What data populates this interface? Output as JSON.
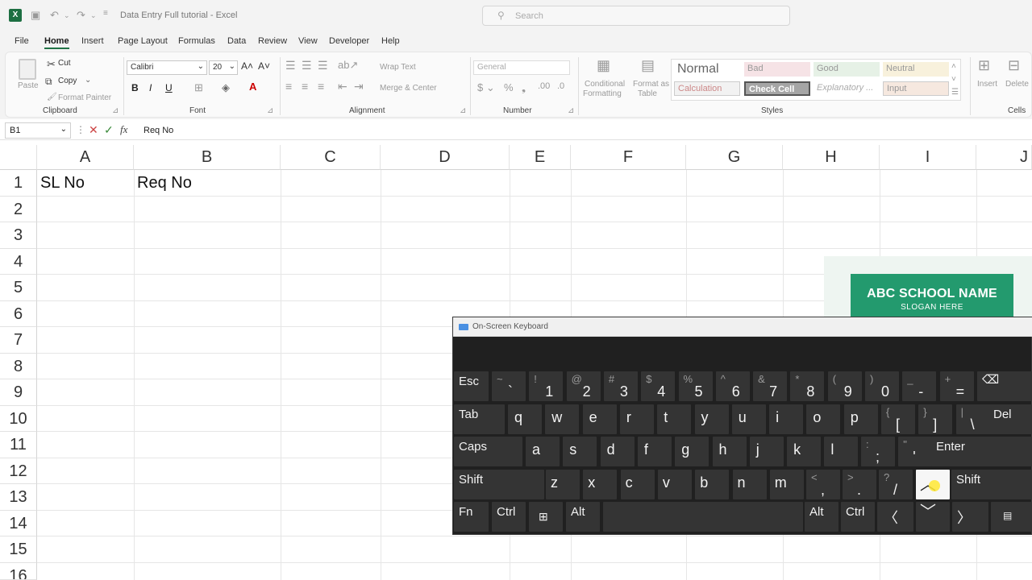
{
  "titlebar": {
    "title": "Data Entry Full tutorial  -  Excel",
    "search_placeholder": "Search",
    "logo": "X"
  },
  "menu": [
    "File",
    "Home",
    "Insert",
    "Page Layout",
    "Formulas",
    "Data",
    "Review",
    "View",
    "Developer",
    "Help"
  ],
  "ribbon": {
    "paste": "Paste",
    "cut": "Cut",
    "copy": "Copy",
    "format_painter": "Format Painter",
    "font_name": "Calibri",
    "font_size": "20",
    "bold": "B",
    "italic": "I",
    "underline": "U",
    "wrap_text": "Wrap Text",
    "merge_center": "Merge & Center",
    "number_format": "General",
    "cond_formatting": [
      "Conditional",
      "Formatting"
    ],
    "format_table": [
      "Format as",
      "Table"
    ],
    "styles": {
      "normal": "Normal",
      "bad": "Bad",
      "good": "Good",
      "neutral": "Neutral",
      "calculation": "Calculation",
      "check_cell": "Check Cell",
      "explanatory": "Explanatory ...",
      "input": "Input"
    },
    "insert": "Insert",
    "delete": "Delete",
    "groups": {
      "clipboard": "Clipboard",
      "font": "Font",
      "alignment": "Alignment",
      "number": "Number",
      "styles": "Styles",
      "cells": "Cells"
    }
  },
  "formula_bar": {
    "name_box": "B1",
    "fx": "fx",
    "content": "Req No"
  },
  "grid": {
    "columns": [
      "A",
      "B",
      "C",
      "D",
      "E",
      "F",
      "G",
      "H",
      "I",
      "J"
    ],
    "rows": [
      "1",
      "2",
      "3",
      "4",
      "5",
      "6",
      "7",
      "8",
      "9",
      "10",
      "11",
      "12",
      "13",
      "14",
      "15",
      "16"
    ],
    "cells": {
      "A1": "SL No",
      "B1": "Req No"
    }
  },
  "shape": {
    "name": "ABC SCHOOL NAME",
    "slogan": "SLOGAN HERE"
  },
  "osk": {
    "title": "On-Screen Keyboard",
    "keys": {
      "esc": "Esc",
      "tab": "Tab",
      "caps": "Caps",
      "shift": "Shift",
      "enter": "Enter",
      "del": "Del",
      "fn": "Fn",
      "ctrl": "Ctrl",
      "alt": "Alt"
    },
    "row1": [
      {
        "s": "~",
        "m": "`"
      },
      {
        "s": "!",
        "m": "1"
      },
      {
        "s": "@",
        "m": "2"
      },
      {
        "s": "#",
        "m": "3"
      },
      {
        "s": "$",
        "m": "4"
      },
      {
        "s": "%",
        "m": "5"
      },
      {
        "s": "^",
        "m": "6"
      },
      {
        "s": "&",
        "m": "7"
      },
      {
        "s": "*",
        "m": "8"
      },
      {
        "s": "(",
        "m": "9"
      },
      {
        "s": ")",
        "m": "0"
      },
      {
        "s": "_",
        "m": "-"
      },
      {
        "s": "+",
        "m": "="
      }
    ],
    "row2": [
      "q",
      "w",
      "e",
      "r",
      "t",
      "y",
      "u",
      "i",
      "o",
      "p"
    ],
    "row2_extra": [
      {
        "s": "{",
        "m": "["
      },
      {
        "s": "}",
        "m": "]"
      },
      {
        "s": "|",
        "m": "\\"
      }
    ],
    "row3": [
      "a",
      "s",
      "d",
      "f",
      "g",
      "h",
      "j",
      "k",
      "l"
    ],
    "row3_extra": [
      {
        "s": ":",
        "m": ";"
      },
      {
        "s": "\"",
        "m": "'"
      }
    ],
    "row4": [
      "z",
      "x",
      "c",
      "v",
      "b",
      "n",
      "m"
    ],
    "row4_extra": [
      {
        "s": "<",
        "m": ","
      },
      {
        "s": ">",
        "m": "."
      },
      {
        "s": "?",
        "m": "/"
      }
    ]
  }
}
